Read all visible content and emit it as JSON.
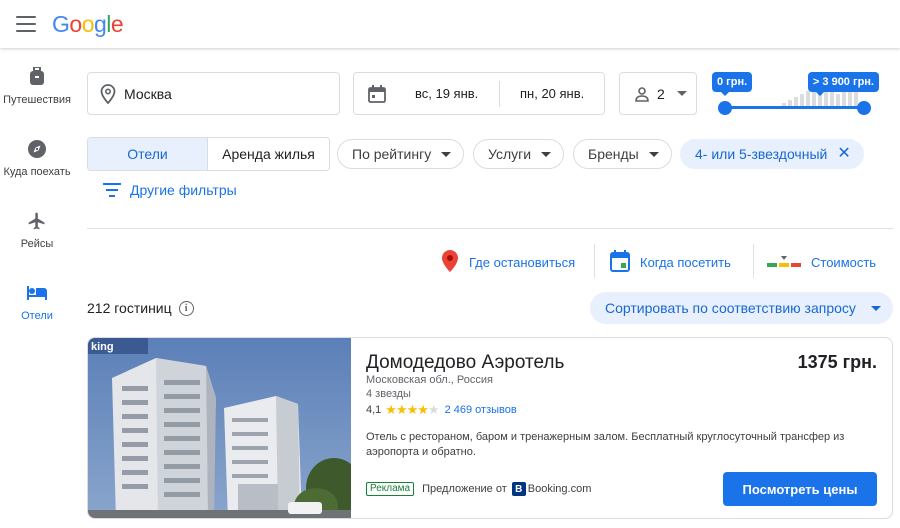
{
  "header": {
    "menu_icon": "hamburger-menu-icon",
    "logo": {
      "text": "Google",
      "letters": [
        "G",
        "o",
        "o",
        "g",
        "l",
        "e"
      ],
      "colors": [
        "#4285f4",
        "#ea4335",
        "#fbbc05",
        "#4285f4",
        "#34a853",
        "#ea4335"
      ]
    }
  },
  "sidebar": {
    "items": [
      {
        "label": "Путешествия",
        "icon": "luggage-icon",
        "active": false
      },
      {
        "label": "Куда поехать",
        "icon": "compass-icon",
        "active": false
      },
      {
        "label": "Рейсы",
        "icon": "airplane-icon",
        "active": false
      },
      {
        "label": "Отели",
        "icon": "bed-icon",
        "active": true
      }
    ]
  },
  "search": {
    "location": "Москва",
    "checkin": "вс, 19 янв.",
    "checkout": "пн, 20 янв.",
    "guests": "2",
    "price_min": "0 грн.",
    "price_max": "> 3 900 грн."
  },
  "filters": {
    "segment": [
      "Отели",
      "Аренда жилья"
    ],
    "chips": [
      "По рейтингу",
      "Услуги",
      "Бренды"
    ],
    "selected_chip": "4- или 5-звездочный",
    "more_filters": "Другие фильтры"
  },
  "view_tabs": [
    "Где остановиться",
    "Когда посетить",
    "Стоимость"
  ],
  "results": {
    "count": "212 гостиниц",
    "sort": "Сортировать по соответствию запросу"
  },
  "hotel": {
    "photo_watermark": "king",
    "name": "Домодедово Аэротель",
    "price": "1375 грн.",
    "location": "Московская обл., Россия",
    "stars": "4 звезды",
    "rating": "4,1",
    "rating_value": 4.1,
    "reviews": "2 469 отзывов",
    "description": "Отель с рестораном, баром и тренажерным залом. Бесплатный круглосуточный трансфер из аэропорта и обратно.",
    "ad_label": "Реклама",
    "offer_from": "Предложение от",
    "provider_logo": "B",
    "provider": "Booking.com",
    "cta": "Посмотреть цены"
  },
  "colors": {
    "accent": "#1a73e8",
    "chip_selected_bg": "#e8f0fe",
    "star": "#fbbc04",
    "ad_green": "#188038"
  }
}
